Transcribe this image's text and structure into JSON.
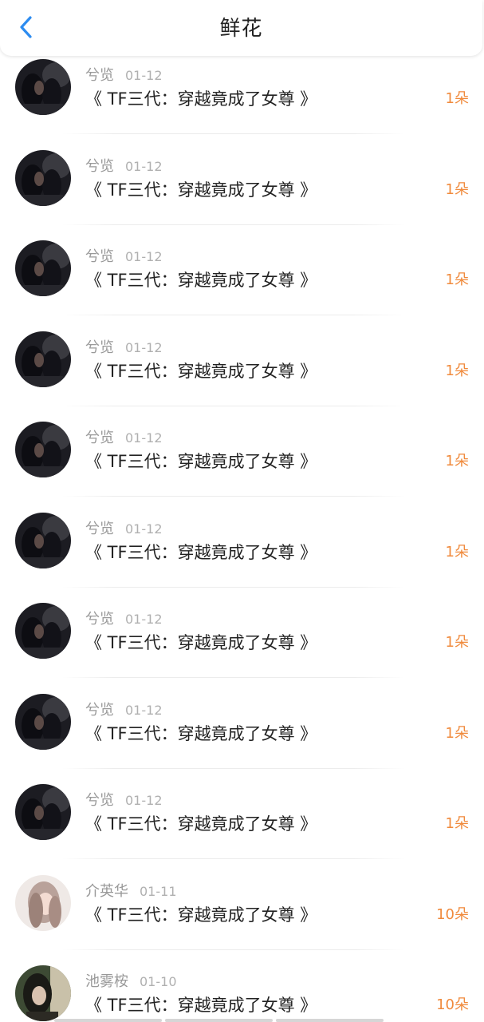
{
  "header": {
    "title": "鲜花",
    "back_icon": "chevron-left-icon",
    "accent_color": "#2d8cf0"
  },
  "colors": {
    "count": "#f08a3c",
    "name": "#999999"
  },
  "items": [
    {
      "user": "兮览",
      "date": "01-12",
      "book": "《 TF三代：穿越竟成了女尊 》",
      "count": "1朵",
      "avatar": "dark"
    },
    {
      "user": "兮览",
      "date": "01-12",
      "book": "《 TF三代：穿越竟成了女尊 》",
      "count": "1朵",
      "avatar": "dark"
    },
    {
      "user": "兮览",
      "date": "01-12",
      "book": "《 TF三代：穿越竟成了女尊 》",
      "count": "1朵",
      "avatar": "dark"
    },
    {
      "user": "兮览",
      "date": "01-12",
      "book": "《 TF三代：穿越竟成了女尊 》",
      "count": "1朵",
      "avatar": "dark"
    },
    {
      "user": "兮览",
      "date": "01-12",
      "book": "《 TF三代：穿越竟成了女尊 》",
      "count": "1朵",
      "avatar": "dark"
    },
    {
      "user": "兮览",
      "date": "01-12",
      "book": "《 TF三代：穿越竟成了女尊 》",
      "count": "1朵",
      "avatar": "dark"
    },
    {
      "user": "兮览",
      "date": "01-12",
      "book": "《 TF三代：穿越竟成了女尊 》",
      "count": "1朵",
      "avatar": "dark"
    },
    {
      "user": "兮览",
      "date": "01-12",
      "book": "《 TF三代：穿越竟成了女尊 》",
      "count": "1朵",
      "avatar": "dark"
    },
    {
      "user": "兮览",
      "date": "01-12",
      "book": "《 TF三代：穿越竟成了女尊 》",
      "count": "1朵",
      "avatar": "dark"
    },
    {
      "user": "介英华",
      "date": "01-11",
      "book": "《 TF三代：穿越竟成了女尊 》",
      "count": "10朵",
      "avatar": "light"
    },
    {
      "user": "池雾桉",
      "date": "01-10",
      "book": "《 TF三代：穿越竟成了女尊 》",
      "count": "10朵",
      "avatar": "green"
    }
  ]
}
